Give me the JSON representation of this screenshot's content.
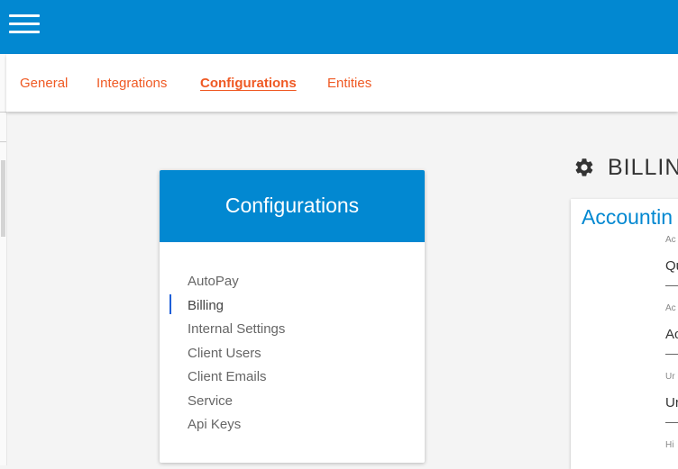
{
  "topbar": {
    "menu_icon": "hamburger-menu-icon",
    "color": "#0288d1"
  },
  "tabs": [
    {
      "label": "General",
      "active": false
    },
    {
      "label": "Integrations",
      "active": false
    },
    {
      "label": "Configurations",
      "active": true
    },
    {
      "label": "Entities",
      "active": false
    }
  ],
  "sidebar_card": {
    "title": "Configurations",
    "items": [
      {
        "label": "AutoPay"
      },
      {
        "label": "Billing",
        "selected": true
      },
      {
        "label": "Internal Settings"
      },
      {
        "label": "Client Users"
      },
      {
        "label": "Client Emails"
      },
      {
        "label": "Service"
      },
      {
        "label": "Api Keys"
      }
    ]
  },
  "section": {
    "icon": "gear-icon",
    "title": "BILLIN"
  },
  "panel": {
    "title": "Accountin",
    "fields": [
      {
        "label": "Ac",
        "value": "Qu"
      },
      {
        "label": "Ac",
        "value": "Ac"
      },
      {
        "label": "Ur",
        "value": "Ur"
      },
      {
        "label": "Hi",
        "value": ""
      }
    ]
  },
  "colors": {
    "accent": "#0288d1",
    "tab_text": "#ef5a24",
    "selected_marker": "#1e5fd8"
  }
}
